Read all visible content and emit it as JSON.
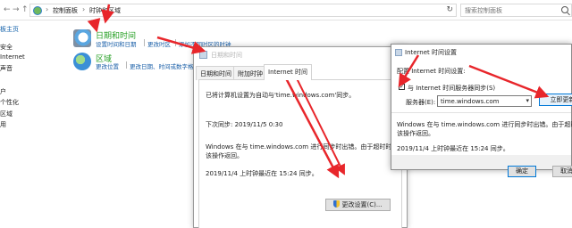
{
  "addressbar": {
    "back": "←",
    "forward": "→",
    "up": "↑",
    "crumbs": [
      "控制面板",
      "时钟和区域"
    ],
    "refresh": "↻",
    "search_placeholder": "搜索控制面板"
  },
  "sidebar": {
    "items": [
      "板主页",
      "安全",
      "Internet",
      "声音",
      "户",
      "个性化",
      "区域",
      "用"
    ]
  },
  "categories": {
    "datetime": {
      "title": "日期和时间",
      "links": [
        "设置时间和日期",
        "更改时区",
        "添加不同时区的时钟"
      ]
    },
    "region": {
      "title": "区域",
      "links": [
        "更改位置",
        "更改日期、时间或数字格式"
      ]
    }
  },
  "dt_dialog": {
    "title": "日期和时间",
    "tabs": [
      "日期和时间",
      "附加时钟",
      "Internet 时间"
    ],
    "active_tab": 2,
    "sync_text": "已将计算机设置为自动与'time.windows.com'同步。",
    "next_sync": "下次同步: 2019/11/5 0:30",
    "error_line1": "Windows 在与 time.windows.com 进行同步时出错。由于超时时间已",
    "error_line2": "该操作返回。",
    "last_sync": "2019/11/4 上时钟最近在 15:24 同步。",
    "change_button": "更改设置(C)..."
  },
  "it_dialog": {
    "title": "Internet 时间设置",
    "config_label": "配置 Internet 时间设置:",
    "sync_checkbox_label": "与 Internet 时间服务器同步(S)",
    "sync_checked": true,
    "server_label": "服务器(E):",
    "server_value": "time.windows.com",
    "update_button": "立即更新",
    "error_line1": "Windows 在与 time.windows.com 进行同步时出错。由于超时时",
    "error_line2": "该操作返回。",
    "last_sync": "2019/11/4 上时钟最近在 15:24 同步。",
    "ok_button": "确定",
    "cancel_button": "取消"
  },
  "colors": {
    "annotation_red": "#e8262b",
    "link_blue": "#1a5fa8",
    "category_green": "#27a025"
  }
}
